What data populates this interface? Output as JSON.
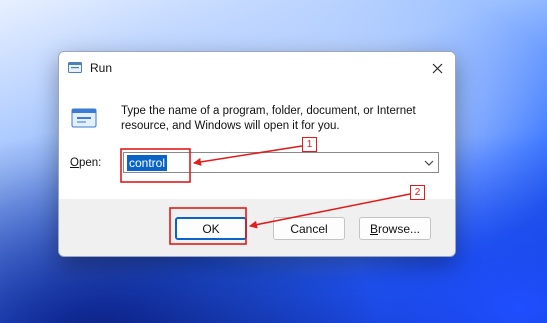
{
  "window": {
    "title": "Run",
    "close_glyph": "✕",
    "title_icon": "run-dialog-icon"
  },
  "content": {
    "description": "Type the name of a program, folder, document, or Internet resource, and Windows will open it for you.",
    "open_label_mnemonic": "O",
    "open_label_rest": "pen:",
    "open_value": "control",
    "dropdown_icon": "chevron-down-icon"
  },
  "buttons": {
    "ok": "OK",
    "cancel": "Cancel",
    "browse_mnemonic": "B",
    "browse_rest": "rowse..."
  },
  "annotations": [
    {
      "number": "1"
    },
    {
      "number": "2"
    }
  ],
  "colors": {
    "annotation_red": "#e21b1b",
    "selection_blue": "#0a64c8"
  }
}
